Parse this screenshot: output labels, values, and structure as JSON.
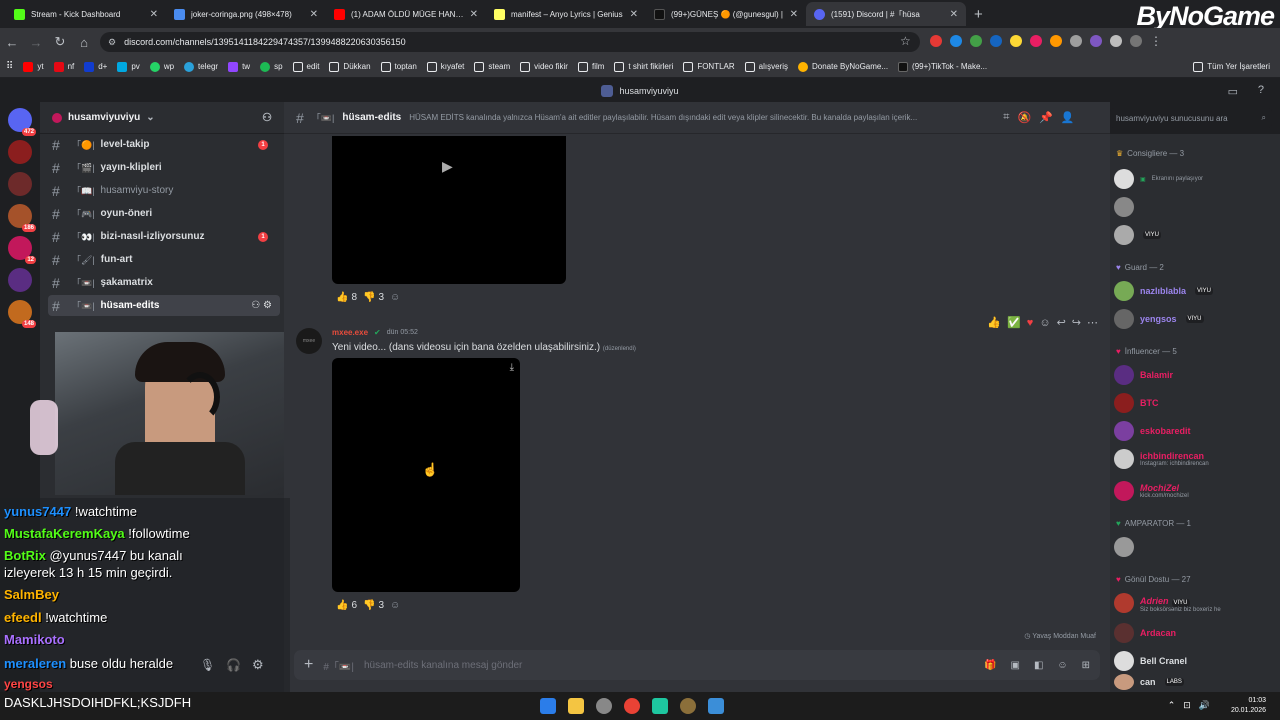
{
  "browser": {
    "tabs": [
      {
        "title": "Stream - Kick Dashboard",
        "color": "#53fc18"
      },
      {
        "title": "joker-coringa.png (498×478)",
        "color": "#4a8cf0"
      },
      {
        "title": "(1) ADAM ÖLDÜ MÜGE HANIM",
        "color": "#ff0000"
      },
      {
        "title": "manifest – Anyo Lyrics | Genius",
        "color": "#ffff64"
      },
      {
        "title": "(99+)GÜNEŞ 🟠 (@gunesgul) |",
        "color": "#111111"
      },
      {
        "title": "(1591) Discord | #「hüsa",
        "color": "#5865f2"
      }
    ],
    "url": "discord.com/channels/1395141184229474357/1399488220630356150",
    "bookmarks": [
      "yt",
      "nf",
      "d+",
      "pv",
      "wp",
      "telegr",
      "tw",
      "sp",
      "edit",
      "Dükkan",
      "toptan",
      "kıyafet",
      "steam",
      "video fikir",
      "film",
      "t shirt fikirleri",
      "FONTLAR",
      "alışveriş",
      "Donate ByNoGame...",
      "(99+)TikTok - Make..."
    ],
    "all_bookmarks": "Tüm Yer İşaretleri",
    "logo": "ByNoGame"
  },
  "discord": {
    "top_title": "husamviyuviyu",
    "server_name": "husamviyuviyu",
    "server_badges": [
      "472",
      "",
      "",
      "186",
      "12",
      "",
      "148"
    ],
    "channels": [
      {
        "name": "level-takip",
        "bold": true,
        "badge": "1"
      },
      {
        "name": "yayın-klipleri",
        "bold": true,
        "badge": ""
      },
      {
        "name": "husamviyu-story",
        "bold": false,
        "badge": ""
      },
      {
        "name": "oyun-öneri",
        "bold": true,
        "badge": ""
      },
      {
        "name": "bizi-nasıl-izliyorsunuz",
        "bold": true,
        "badge": "1"
      },
      {
        "name": "fun-art",
        "bold": true,
        "badge": ""
      },
      {
        "name": "şakamatrix",
        "bold": true,
        "badge": ""
      },
      {
        "name": "hüsam-edits",
        "bold": true,
        "badge": "",
        "active": true
      }
    ],
    "channel_title": "hüsam-edits",
    "topic": "HÜSAM EDİTS kanalında yalnızca Hüsam'a ait editler paylaşılabilir. Hüsam dışındaki edit veya klipler silinecektir. Bu kanalda paylaşılan içerik...",
    "search_placeholder": "husamviyuviyu sunucusunu ara",
    "msg1_reactions": [
      {
        "emoji": "👍",
        "count": "8"
      },
      {
        "emoji": "👎",
        "count": "3"
      }
    ],
    "msg2": {
      "author": "mxee.exe",
      "time": "dün 05:52",
      "text": "Yeni video... (dans videosu için bana özelden ulaşabilirsiniz.)",
      "edited": "(düzenlendi)",
      "reactions": [
        {
          "emoji": "👍",
          "count": "6"
        },
        {
          "emoji": "👎",
          "count": "3"
        }
      ]
    },
    "slow_mode": "Yavaş Moddan Muaf",
    "input_placeholder": "hüsam-edits kanalına mesaj gönder",
    "member_groups": [
      {
        "name": "Consigliere — 3"
      },
      {
        "name": "Guard — 2"
      },
      {
        "name": "İnfluencer — 5"
      },
      {
        "name": "AMPARATOR — 1"
      },
      {
        "name": "Gönül Dostu — 27"
      }
    ],
    "members": [
      {
        "name": "",
        "status": "Ekranını paylaşıyor",
        "color": "#dbdee1"
      },
      {
        "name": "",
        "status": "",
        "color": "#dbdee1"
      },
      {
        "name": "",
        "tag": "VIYU",
        "color": "#dbdee1"
      },
      {
        "name": "nazlıblabla",
        "tag": "VIYU",
        "color": "#9b84ec"
      },
      {
        "name": "yengsos",
        "tag": "VIYU",
        "color": "#9b84ec"
      },
      {
        "name": "Balamir",
        "color": "#e91e63"
      },
      {
        "name": "BTC",
        "color": "#e91e63"
      },
      {
        "name": "eskobaredit",
        "color": "#e91e63"
      },
      {
        "name": "ichbindirencan",
        "status": "Instagram: ichbindirencan",
        "color": "#e91e63"
      },
      {
        "name": "MochiZel",
        "status": "kick.com/mochizel",
        "color": "#e91e63"
      },
      {
        "name": "",
        "color": "#dbdee1"
      },
      {
        "name": "Adrien",
        "tag": "VIYU",
        "status": "Siz boksörsəniz biz boxeriz he",
        "color": "#e91e63"
      },
      {
        "name": "Ardacan",
        "color": "#e91e63"
      },
      {
        "name": "Bell Cranel",
        "color": "#dbdee1"
      },
      {
        "name": "can",
        "tag": "LABS",
        "color": "#dbdee1"
      }
    ]
  },
  "stream_chat": [
    {
      "user": "yunus7447",
      "msg": "!watchtime",
      "color": "#1e90ff"
    },
    {
      "user": "MustafaKeremKaya",
      "msg": "!followtime",
      "color": "#53fc18"
    },
    {
      "user": "BotRix",
      "msg": "@yunus7447 bu kanalı",
      "color": "#53fc18"
    },
    {
      "user": "",
      "msg": "izleyerek 13 h 15 min geçirdi.",
      "color": "#ffffff"
    },
    {
      "user": "SalmBey",
      "msg": "",
      "color": "#ffb400"
    },
    {
      "user": "efeedl",
      "msg": "!watchtime",
      "color": "#ffb400"
    },
    {
      "user": "Mamikoto",
      "msg": "",
      "color": "#a970ff"
    },
    {
      "user": "meraleren",
      "msg": "buse oldu heralde",
      "color": "#1e90ff"
    },
    {
      "user": "yengsos",
      "msg": "",
      "color": "#ff4545"
    }
  ],
  "taskbar": {
    "text": "DASKLJHSDOIHDFKL;KSJDFH",
    "time": "01:03",
    "date": "20.01.2026"
  }
}
